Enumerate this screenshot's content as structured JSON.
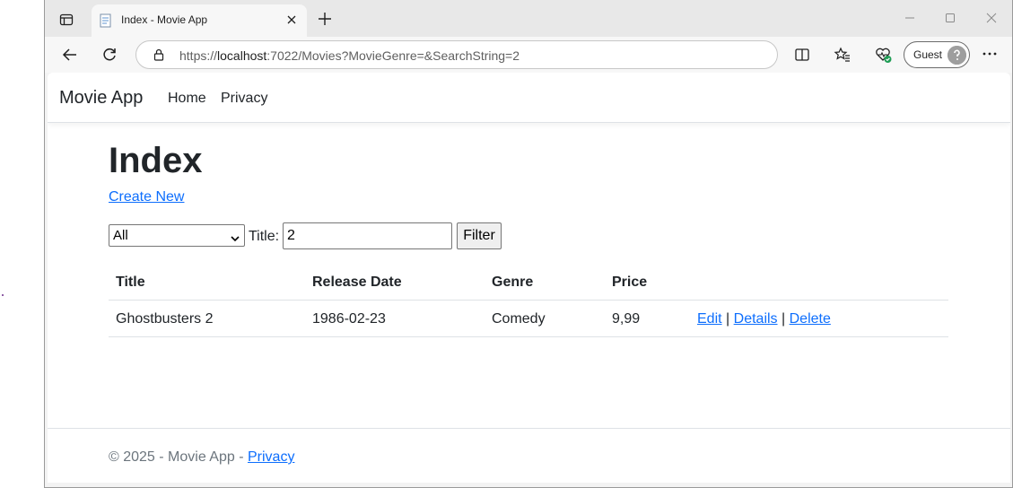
{
  "browser": {
    "tab_title": "Index - Movie App",
    "url_prefix": "https://",
    "url_host": "localhost",
    "url_rest": ":7022/Movies?MovieGenre=&SearchString=2",
    "profile_label": "Guest"
  },
  "navbar": {
    "brand": "Movie App",
    "links": [
      "Home",
      "Privacy"
    ]
  },
  "page": {
    "heading": "Index",
    "create_link": "Create New",
    "filter": {
      "genre_selected": "All",
      "title_label": "Title:",
      "title_value": "2",
      "button_label": "Filter"
    },
    "table": {
      "headers": [
        "Title",
        "Release Date",
        "Genre",
        "Price"
      ],
      "rows": [
        {
          "title": "Ghostbusters 2",
          "release_date": "1986-02-23",
          "genre": "Comedy",
          "price": "9,99",
          "actions": [
            "Edit",
            "Details",
            "Delete"
          ],
          "separator": "|"
        }
      ]
    }
  },
  "footer": {
    "text": "© 2025 - Movie App - ",
    "privacy_link": "Privacy"
  }
}
